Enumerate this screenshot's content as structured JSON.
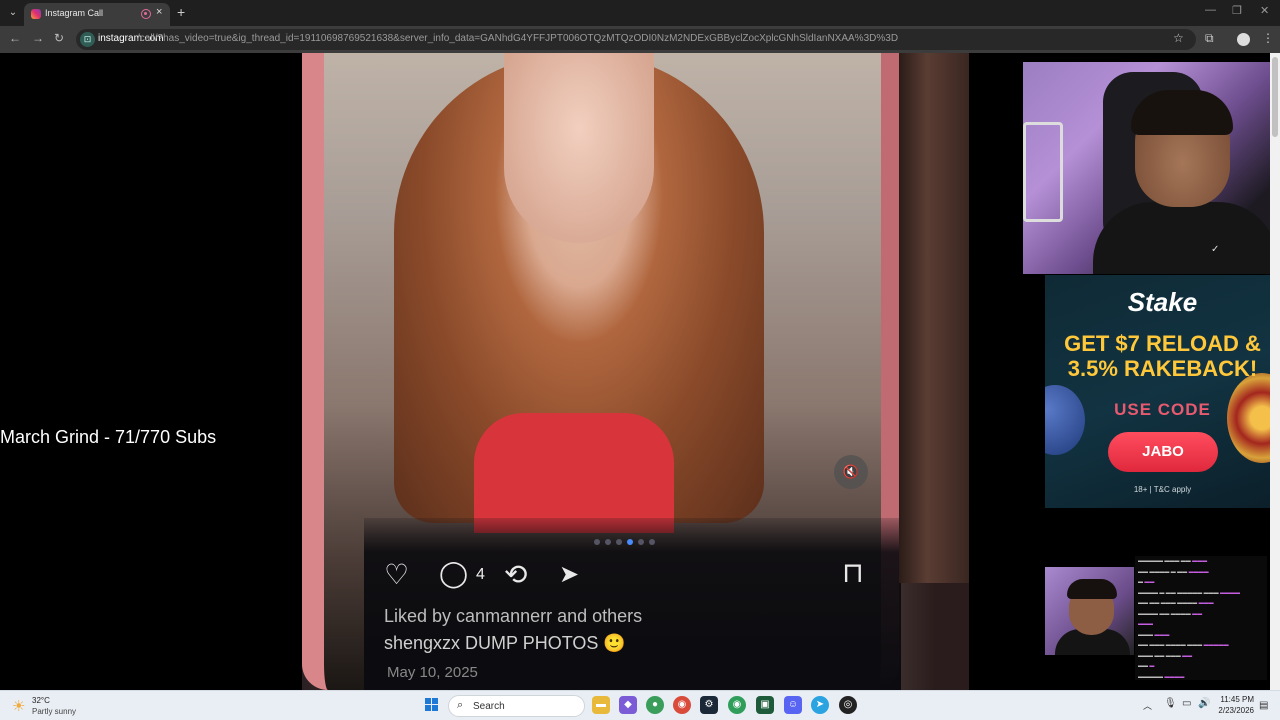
{
  "browser": {
    "tab_title": "Instagram Call",
    "tab_close": "×",
    "new_tab": "+",
    "url_host": "instagram.com",
    "url_path": "/call/?has_video=true&ig_thread_id=19110698769521638&server_info_data=GANhdG4YFFJPT006OTQzMTQzODI0NzM2NDExGBByclZocXplcGNhSldIanNXAA%3D%3D",
    "site_icon": "⊡"
  },
  "overlay": {
    "goal_text": "March Grind - 71/770 Subs"
  },
  "post": {
    "comment_count": "4",
    "liked_by": "Liked by canmannerr and others",
    "caption": "shengxzx DUMP PHOTOS 🙂",
    "date": "May 10, 2025"
  },
  "ad": {
    "brand": "Stake",
    "headline": "GET $7 RELOAD & 3.5% RAKEBACK!",
    "use_code": "USE CODE",
    "code": "JABO",
    "footnote": "18+ | T&C apply"
  },
  "webcam": {
    "shirt_logo": "✓"
  },
  "taskbar": {
    "temperature": "32°C",
    "weather": "Partly sunny",
    "search_label": "Search",
    "time": "11:45 PM",
    "date": "2/23/2026"
  },
  "icons": {
    "heart": "♡",
    "comment": "◯",
    "repost": "⟲",
    "share": "➤",
    "bookmark": "⊓",
    "mute": "🔇"
  },
  "colors": {
    "accent_blue": "#4a8cff",
    "stake_yellow": "#ffc83a",
    "stake_red": "#e0283c"
  }
}
